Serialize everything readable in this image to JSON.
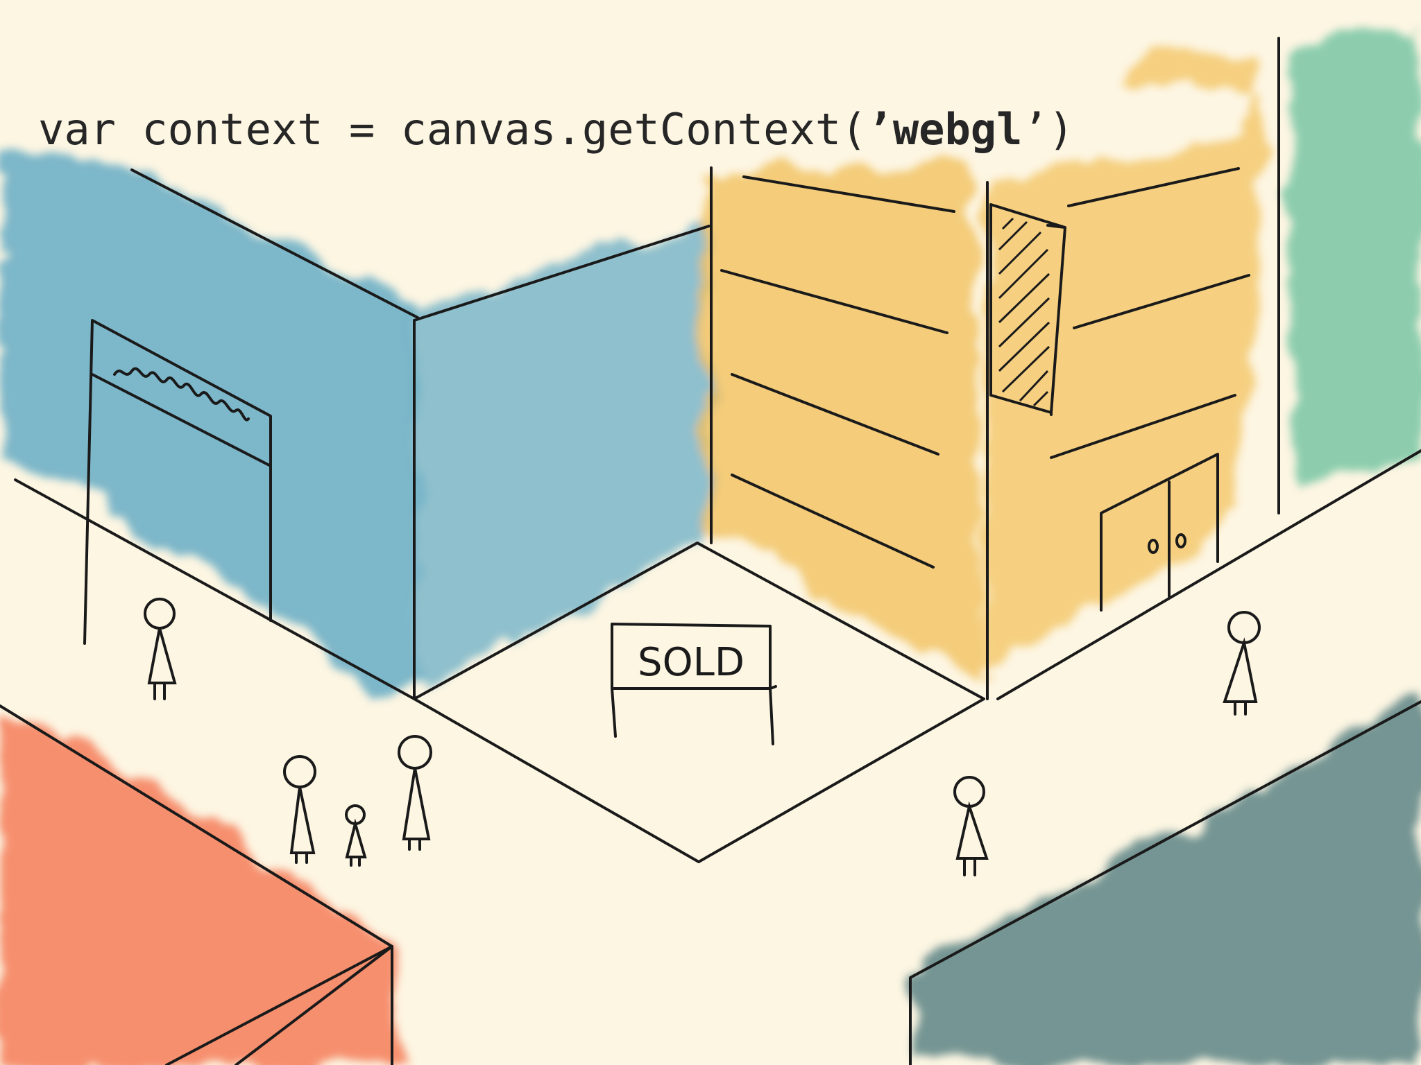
{
  "code": {
    "keyword": "var",
    "variable": "context",
    "operator": "=",
    "call_prefix": "canvas.getContext(",
    "quote_open": "’",
    "argument": "webgl",
    "quote_close": "’)"
  },
  "sign": {
    "text": "SOLD"
  },
  "colors": {
    "background": "#fdf6e3",
    "ink": "#1a1a1a",
    "blue_wash": "#5da7c3",
    "orange_wash": "#f0bd55",
    "green_wash": "#6fc3a0",
    "red_wash": "#f5815f",
    "slate_wash": "#3f6f73"
  }
}
